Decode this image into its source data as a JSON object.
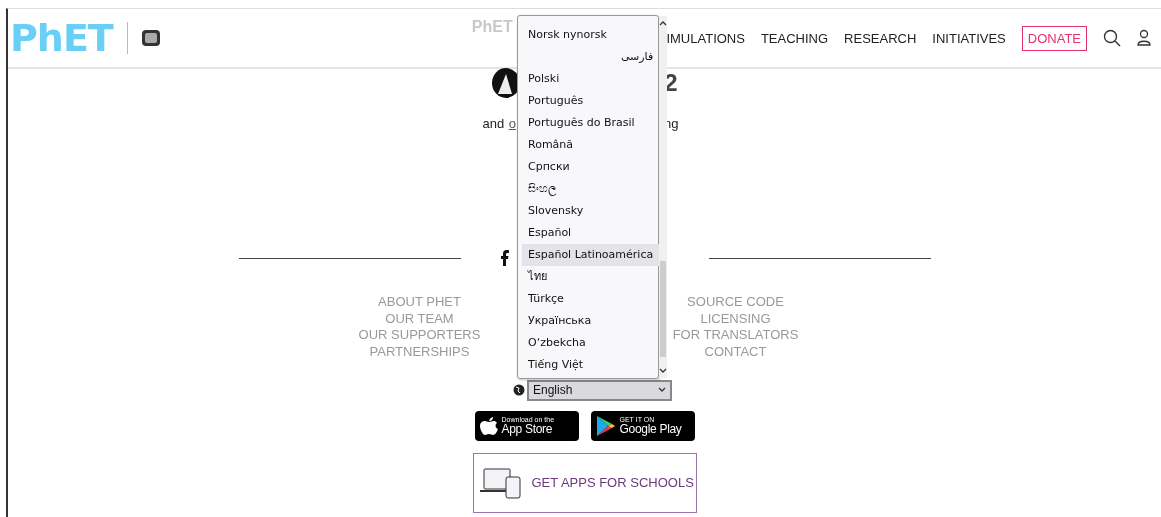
{
  "header": {
    "logo": "PhET",
    "faded_title": "PhET",
    "nav": [
      {
        "label": "IMULATIONS",
        "kind": "link"
      },
      {
        "label": "TEACHING",
        "kind": "link"
      },
      {
        "label": "RESEARCH",
        "kind": "link"
      },
      {
        "label": "INITIATIVES",
        "kind": "link"
      },
      {
        "label": "DONATE",
        "kind": "donate"
      }
    ]
  },
  "intro": {
    "heading_tail": "2",
    "line_start": "and",
    "link_start": "o",
    "line_end": "ng"
  },
  "footer": {
    "left_links": [
      "ABOUT PHET",
      "OUR TEAM",
      "OUR SUPPORTERS",
      "PARTNERSHIPS"
    ],
    "right_links": [
      "SOURCE CODE",
      "LICENSING",
      "FOR TRANSLATORS",
      "CONTACT"
    ]
  },
  "language": {
    "value": "English",
    "expanded": true,
    "options": [
      {
        "label": "Norsk nynorsk",
        "selected": false,
        "rtl": false
      },
      {
        "label": "فارسی",
        "selected": false,
        "rtl": true
      },
      {
        "label": "Polski",
        "selected": false,
        "rtl": false
      },
      {
        "label": "Português",
        "selected": false,
        "rtl": false
      },
      {
        "label": "Português do Brasil",
        "selected": false,
        "rtl": false
      },
      {
        "label": "Română",
        "selected": false,
        "rtl": false
      },
      {
        "label": "Српски",
        "selected": false,
        "rtl": false
      },
      {
        "label": "සිංහල",
        "selected": false,
        "rtl": false
      },
      {
        "label": "Slovensky",
        "selected": false,
        "rtl": false
      },
      {
        "label": "Español",
        "selected": false,
        "rtl": false
      },
      {
        "label": "Español Latinoamérica",
        "selected": true,
        "rtl": false
      },
      {
        "label": "ไทย",
        "selected": false,
        "rtl": false
      },
      {
        "label": "Türkçe",
        "selected": false,
        "rtl": false
      },
      {
        "label": "Українська",
        "selected": false,
        "rtl": false
      },
      {
        "label": "O‘zbekcha",
        "selected": false,
        "rtl": false
      },
      {
        "label": "Tiếng Việt",
        "selected": false,
        "rtl": false
      }
    ]
  },
  "stores": [
    {
      "small": "Download on the",
      "big": "App Store",
      "kind": "apple"
    },
    {
      "small": "GET IT ON",
      "big": "Google Play",
      "kind": "google"
    }
  ],
  "schools": {
    "label": "GET APPS FOR SCHOOLS"
  }
}
